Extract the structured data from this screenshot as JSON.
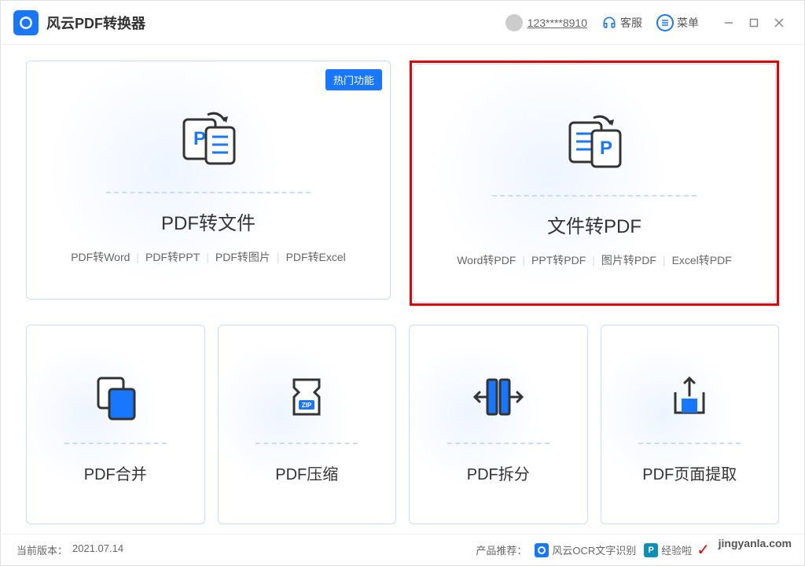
{
  "header": {
    "app_title": "风云PDF转换器",
    "user_name": "123****8910",
    "customer_service": "客服",
    "menu_label": "菜单"
  },
  "cards": {
    "pdf_to_file": {
      "badge": "热门功能",
      "title": "PDF转文件",
      "subs": [
        "PDF转Word",
        "PDF转PPT",
        "PDF转图片",
        "PDF转Excel"
      ]
    },
    "file_to_pdf": {
      "title": "文件转PDF",
      "subs": [
        "Word转PDF",
        "PPT转PDF",
        "图片转PDF",
        "Excel转PDF"
      ]
    },
    "merge": {
      "title": "PDF合并"
    },
    "compress": {
      "title": "PDF压缩"
    },
    "split": {
      "title": "PDF拆分"
    },
    "extract": {
      "title": "PDF页面提取"
    }
  },
  "statusbar": {
    "version_label": "当前版本：",
    "version_value": "2021.07.14",
    "recommend_label": "产品推荐：",
    "promo1": "风云OCR文字识别",
    "promo2": "经验啦",
    "watermark": "jingyanla.com"
  },
  "colors": {
    "primary": "#1976ff",
    "highlight": "#e70000"
  }
}
